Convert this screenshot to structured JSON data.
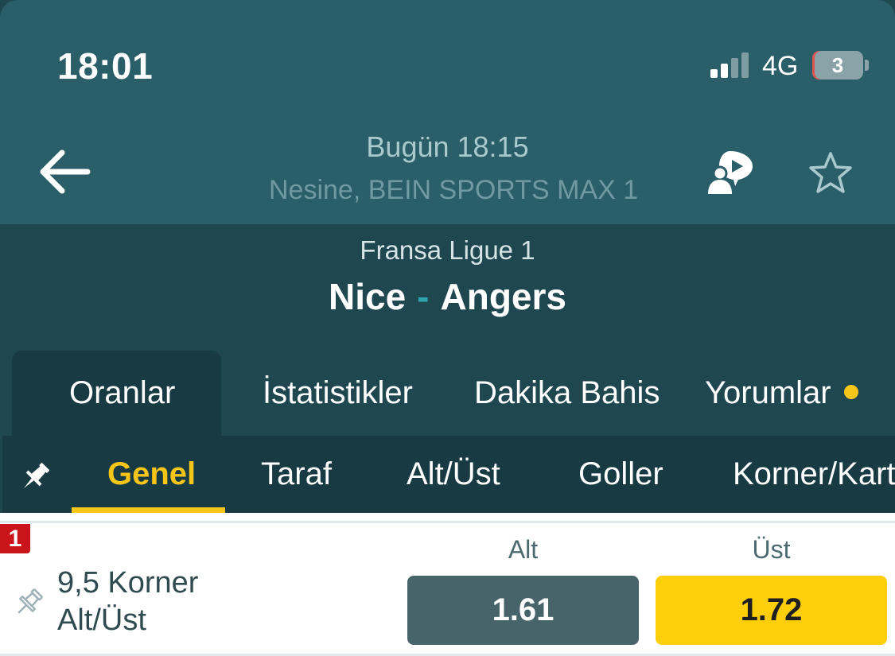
{
  "status_bar": {
    "time": "18:01",
    "network": "4G",
    "battery": "3"
  },
  "header": {
    "back_icon": "arrow-left-icon",
    "date_time": "Bugün 18:15",
    "broadcast": "Nesine, BEIN SPORTS MAX 1",
    "tv_icon": "tv-icon",
    "commentator_icon": "commentator-icon",
    "favorite_icon": "star-icon"
  },
  "match": {
    "league": "Fransa Ligue 1",
    "home": "Nice",
    "separator": "-",
    "away": "Angers"
  },
  "tabs": [
    {
      "label": "Oranlar",
      "active": true
    },
    {
      "label": "İstatistikler",
      "active": false
    },
    {
      "label": "Dakika Bahis",
      "active": false
    },
    {
      "label": "Yorumlar",
      "active": false,
      "has_dot": true
    }
  ],
  "subtabs": [
    {
      "label": "Genel",
      "active": true
    },
    {
      "label": "Taraf",
      "active": false
    },
    {
      "label": "Alt/Üst",
      "active": false
    },
    {
      "label": "Goller",
      "active": false
    },
    {
      "label": "Korner/Kart",
      "active": false
    }
  ],
  "market": {
    "badge": "1",
    "line1": "9,5 Korner",
    "line2": "Alt/Üst",
    "columns": [
      "Alt",
      "Üst"
    ],
    "odds": [
      "1.61",
      "1.72"
    ]
  },
  "colors": {
    "header_bg": "#2a5e69",
    "match_bg": "#1f4750",
    "subbar_bg": "#183a43",
    "accent_yellow": "#f5c518",
    "odd_dark": "#47646b",
    "odd_yellow": "#fccf0a",
    "badge_red": "#c9141b"
  }
}
